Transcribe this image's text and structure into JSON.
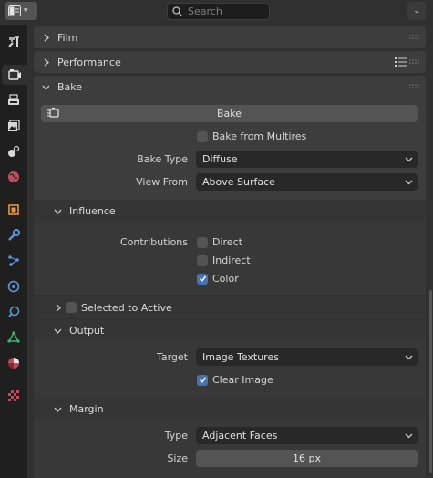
{
  "header": {
    "search_placeholder": "Search"
  },
  "tabs": [
    {
      "name": "tool-icon"
    },
    {
      "name": "render-icon"
    },
    {
      "name": "output-icon"
    },
    {
      "name": "view-layer-icon"
    },
    {
      "name": "scene-icon"
    },
    {
      "name": "world-icon"
    },
    {
      "name": "object-icon"
    },
    {
      "name": "modifier-icon"
    },
    {
      "name": "particles-icon"
    },
    {
      "name": "physics-icon"
    },
    {
      "name": "constraints-icon"
    },
    {
      "name": "data-icon"
    },
    {
      "name": "material-icon"
    },
    {
      "name": "texture-icon"
    }
  ],
  "panels": {
    "film": "Film",
    "performance": "Performance",
    "bake": "Bake"
  },
  "bake": {
    "button_label": "Bake",
    "from_multires": "Bake from Multires",
    "bake_type_label": "Bake Type",
    "bake_type_value": "Diffuse",
    "view_from_label": "View From",
    "view_from_value": "Above Surface"
  },
  "influence": {
    "title": "Influence",
    "contributions_label": "Contributions",
    "direct": "Direct",
    "indirect": "Indirect",
    "color": "Color"
  },
  "selected_to_active": "Selected to Active",
  "output": {
    "title": "Output",
    "target_label": "Target",
    "target_value": "Image Textures",
    "clear_image": "Clear Image"
  },
  "margin": {
    "title": "Margin",
    "type_label": "Type",
    "type_value": "Adjacent Faces",
    "size_label": "Size",
    "size_value": "16 px"
  },
  "colors": {
    "accent": "#4772b3",
    "background": "#303030",
    "panel": "#3d3d3d"
  }
}
